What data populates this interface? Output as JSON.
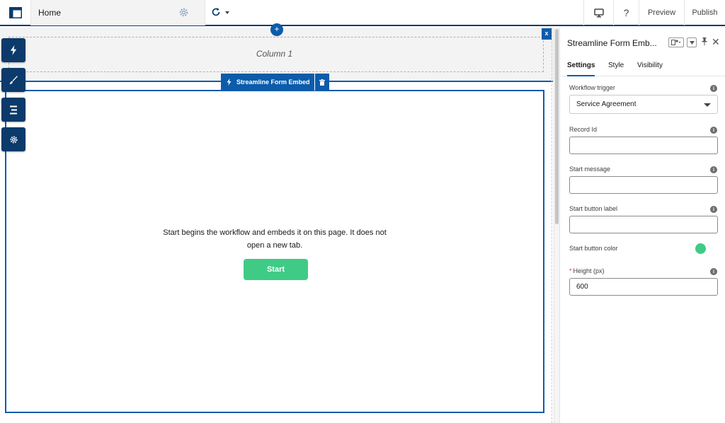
{
  "topbar": {
    "page_name": "Home",
    "help": "?",
    "preview_label": "Preview",
    "publish_label": "Publish"
  },
  "canvas": {
    "column_label": "Column 1",
    "plus_symbol": "+",
    "close_symbol": "x",
    "component_tab_label": "Streamline Form Embed",
    "start_text_line1": "Start begins the workflow and embeds it on this page. It does not",
    "start_text_line2": "open a new tab.",
    "start_button_label": "Start",
    "start_button_color": "#3fcb86"
  },
  "left_tools": [
    {
      "icon": "lightning-icon"
    },
    {
      "icon": "brush-icon"
    },
    {
      "icon": "list-icon"
    },
    {
      "icon": "gear-icon"
    }
  ],
  "panel": {
    "title": "Streamline Form Emb...",
    "tabs": [
      "Settings",
      "Style",
      "Visibility"
    ],
    "active_tab": "Settings",
    "fields": {
      "workflow_trigger_label": "Workflow trigger",
      "workflow_trigger_value": "Service Agreement",
      "record_id_label": "Record Id",
      "record_id_value": "",
      "start_message_label": "Start message",
      "start_message_value": "",
      "start_button_label_label": "Start button label",
      "start_button_label_value": "",
      "start_button_color_label": "Start button color",
      "start_button_color_value": "#3fcb86",
      "height_required_mark": "*",
      "height_label": "Height (px)",
      "height_value": "600"
    },
    "close_symbol": "✕"
  },
  "colors": {
    "brand_dark": "#0b3a6b",
    "brand_blue": "#0b5cab",
    "accent_green": "#3fcb86"
  }
}
